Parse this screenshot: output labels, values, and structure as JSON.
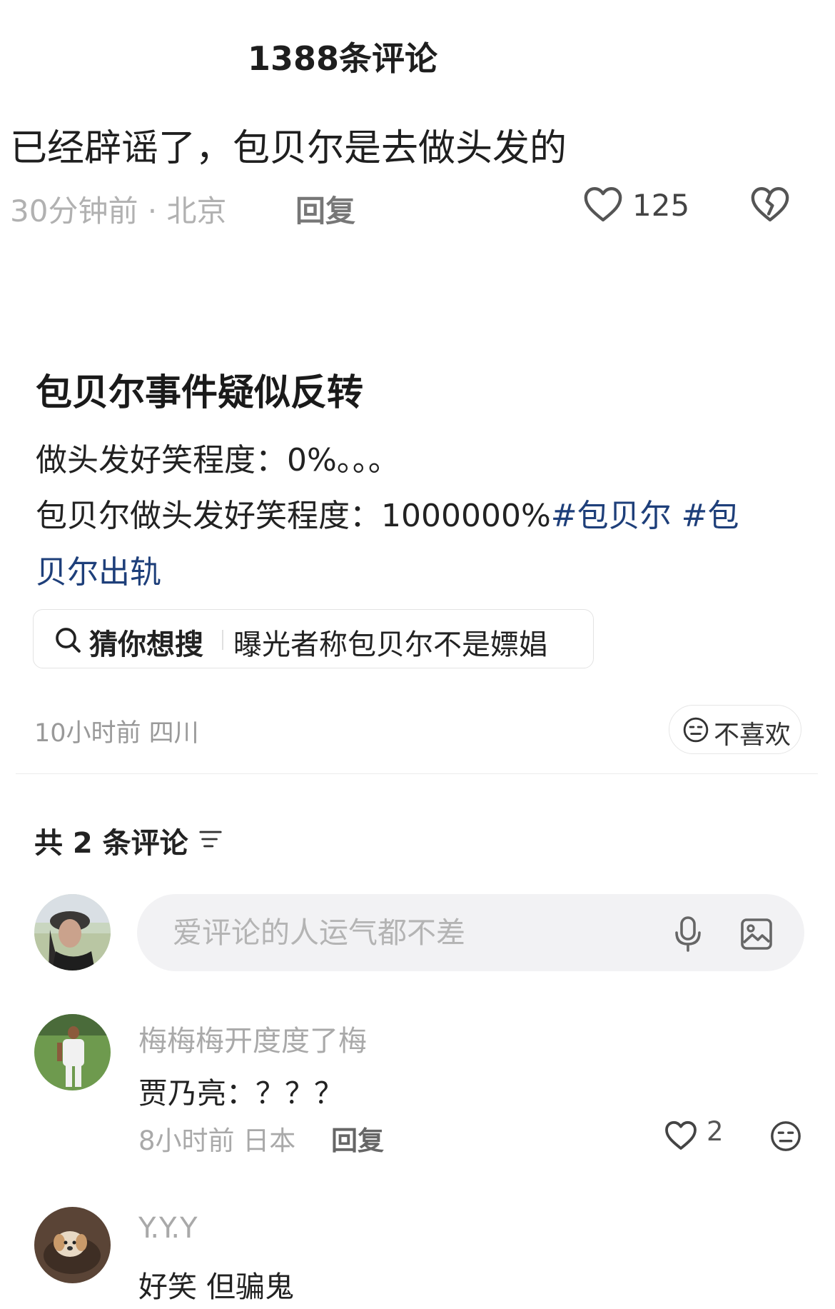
{
  "top_comment": {
    "header": "1388条评论",
    "text": "已经辟谣了，包贝尔是去做头发的",
    "time_location": "30分钟前 · 北京",
    "reply_label": "回复",
    "like_count": "125"
  },
  "post": {
    "title": "包贝尔事件疑似反转",
    "line1": "做头发好笑程度：0%。。。",
    "line2_text": "包贝尔做头发好笑程度：1000000%",
    "hashtag1": "#包贝尔",
    "hashtag2_part1": " #包",
    "hashtag2_part2": "贝尔出轨",
    "search": {
      "guess_label": "猜你想搜",
      "query": "曝光者称包贝尔不是嫖娼"
    },
    "meta": "10小时前 四川",
    "dislike_label": "不喜欢"
  },
  "comments_section": {
    "count_label": "共 2 条评论",
    "input_placeholder": "爱评论的人运气都不差",
    "comments": [
      {
        "name": "梅梅梅开度度了梅",
        "text": "贾乃亮：？？？",
        "time_location": "8小时前 日本",
        "reply_label": "回复",
        "like_count": "2"
      },
      {
        "name": "Y.Y.Y",
        "text": "好笑 但骗鬼"
      }
    ]
  },
  "colors": {
    "hashtag": "#1e3f7a",
    "muted_text": "#a9a9a9",
    "input_bg": "#f2f2f4"
  },
  "icons": [
    "heart-outline-icon",
    "broken-heart-icon",
    "search-icon",
    "neutral-face-icon",
    "sort-icon",
    "microphone-icon",
    "image-icon"
  ]
}
